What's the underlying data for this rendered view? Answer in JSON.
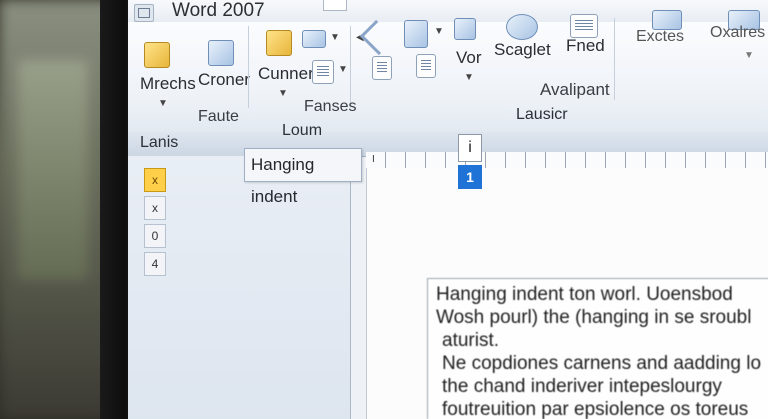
{
  "app": {
    "title": "Word 2007"
  },
  "ribbon": {
    "items": [
      {
        "label": "Mrechs"
      },
      {
        "label": "Croner"
      },
      {
        "label": "Cunner"
      },
      {
        "label": "Vor"
      },
      {
        "label": "Scaglet"
      },
      {
        "label": "Fned"
      },
      {
        "label": "Exctes"
      },
      {
        "label": "Oxalres"
      }
    ],
    "groups": [
      {
        "label": "Faute"
      },
      {
        "label": "Fanses"
      },
      {
        "label": "Avalipant"
      }
    ]
  },
  "band": {
    "left_label": "Lanis",
    "center_label": "Loum",
    "right_label": "Lausicr"
  },
  "left_pane": {
    "buttons": [
      "x",
      "x",
      "0",
      "4"
    ]
  },
  "tooltip": {
    "text": "Hanging indent"
  },
  "ruler": {
    "marker": "I",
    "indent_handle": "i",
    "indent_badge": "1"
  },
  "document": {
    "lines": [
      "Hanging indent ton worl. Uoensbod",
      "Wosh pourl) the (hanging in se sroubl",
      "aturist.",
      "Ne copdiones carnens and aadding lo",
      "the chand inderiver intepeslourgy",
      "foutreuition par epsiolence os toreus"
    ]
  },
  "colors": {
    "accent_blue": "#1f73d6",
    "highlight_yellow": "#ffcf4a",
    "ribbon_bg": "#eef2f7"
  }
}
